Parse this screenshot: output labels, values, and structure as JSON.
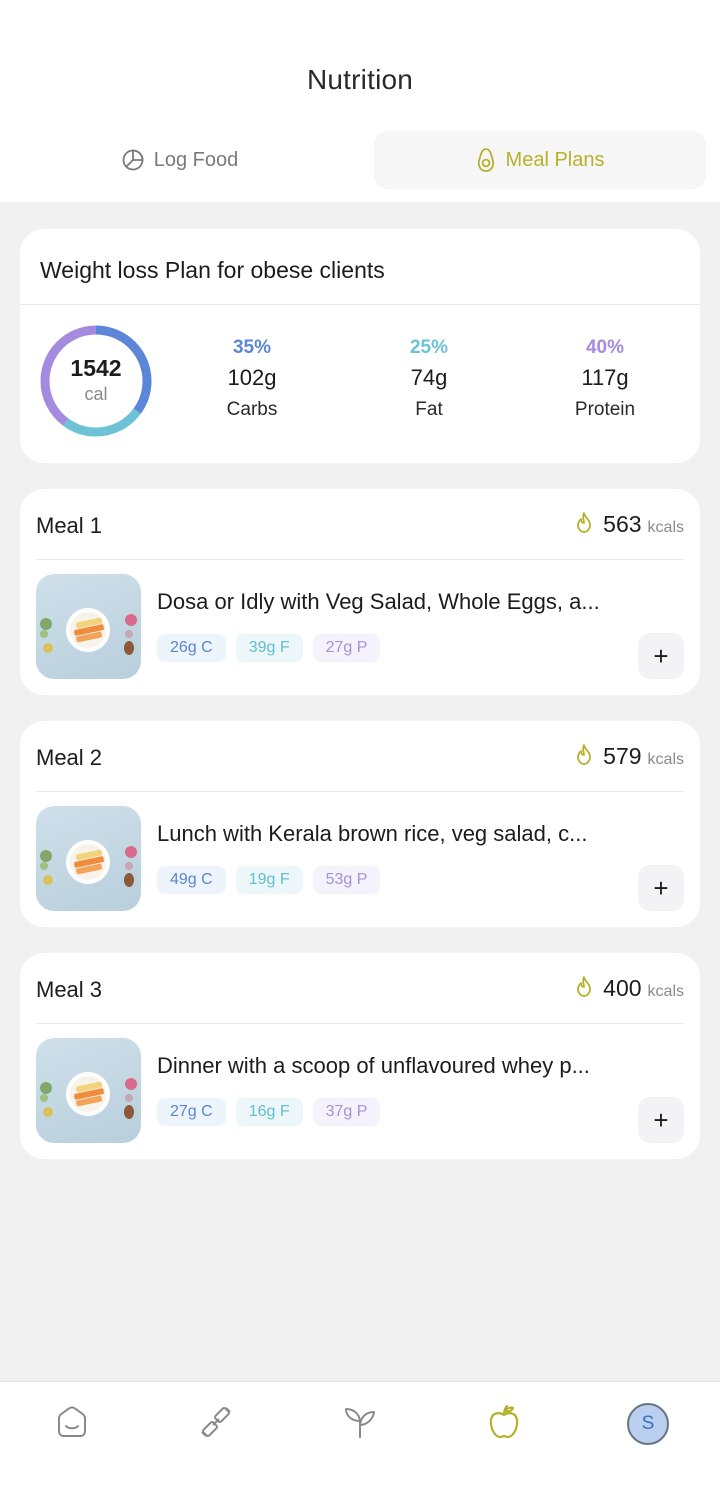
{
  "header": {
    "title": "Nutrition"
  },
  "tabs": [
    {
      "label": "Log Food",
      "icon": "pie-chart-icon",
      "active": false
    },
    {
      "label": "Meal Plans",
      "icon": "avocado-icon",
      "active": true
    }
  ],
  "plan": {
    "title": "Weight loss Plan for obese clients",
    "calories": "1542",
    "calories_unit": "cal",
    "macros": [
      {
        "percent": "35%",
        "grams": "102g",
        "name": "Carbs",
        "color": "#5b86d9"
      },
      {
        "percent": "25%",
        "grams": "74g",
        "name": "Fat",
        "color": "#6cc3d6"
      },
      {
        "percent": "40%",
        "grams": "117g",
        "name": "Protein",
        "color": "#a58be0"
      }
    ],
    "ring_fractions": [
      0.35,
      0.25,
      0.4
    ]
  },
  "meals": [
    {
      "name": "Meal 1",
      "kcal": "563",
      "kcal_unit": "kcals",
      "description": "Dosa or Idly with Veg Salad, Whole Eggs, a...",
      "carbs": "26g C",
      "fat": "39g F",
      "protein": "27g P",
      "add_label": "+"
    },
    {
      "name": "Meal 2",
      "kcal": "579",
      "kcal_unit": "kcals",
      "description": "Lunch with Kerala brown rice, veg salad, c...",
      "carbs": "49g C",
      "fat": "19g F",
      "protein": "53g P",
      "add_label": "+"
    },
    {
      "name": "Meal 3",
      "kcal": "400",
      "kcal_unit": "kcals",
      "description": "Dinner with a scoop of unflavoured whey p...",
      "carbs": "27g C",
      "fat": "16g F",
      "protein": "37g P",
      "add_label": "+"
    }
  ],
  "bottom_nav": [
    {
      "icon": "home-icon",
      "active": false
    },
    {
      "icon": "dumbbell-icon",
      "active": false
    },
    {
      "icon": "plant-icon",
      "active": false
    },
    {
      "icon": "apple-icon",
      "active": true
    },
    {
      "icon": "profile-avatar",
      "initial": "S",
      "active": false
    }
  ],
  "colors": {
    "accent": "#b5b22a",
    "carbs": "#5b86d9",
    "fat": "#6cc3d6",
    "protein": "#a58be0"
  }
}
